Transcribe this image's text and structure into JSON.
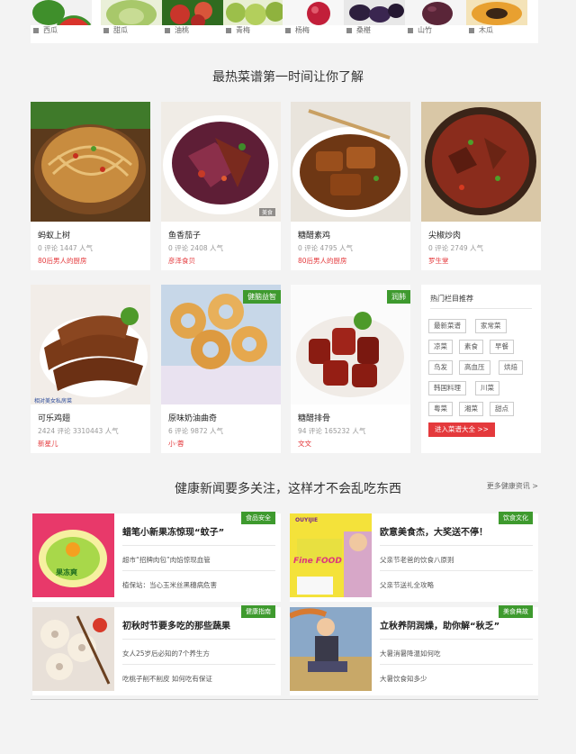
{
  "fruits": [
    {
      "label": "西瓜",
      "color": "#3f8f2b"
    },
    {
      "label": "甜瓜",
      "color": "#a8c86a"
    },
    {
      "label": "油桃",
      "color": "#c9352b"
    },
    {
      "label": "青梅",
      "color": "#9cbf4a"
    },
    {
      "label": "杨梅",
      "color": "#c21f3a"
    },
    {
      "label": "桑椹",
      "color": "#2d1f3d"
    },
    {
      "label": "山竹",
      "color": "#5a2538"
    },
    {
      "label": "木瓜",
      "color": "#e8a030"
    }
  ],
  "recipes_section": {
    "title": "最热菜谱第一时间让你了解"
  },
  "recipes": [
    {
      "name": "蚂蚁上树",
      "stats": "0 评论  1447 人气",
      "author": "80后男人的厨房",
      "tag": ""
    },
    {
      "name": "鱼香茄子",
      "stats": "0 评论  2408 人气",
      "author": "彦泽食贝",
      "tag": ""
    },
    {
      "name": "糖醋素鸡",
      "stats": "0 评论  4795 人气",
      "author": "80后男人的厨房",
      "tag": ""
    },
    {
      "name": "尖椒炒肉",
      "stats": "0 评论  2749 人气",
      "author": "罗生堂",
      "tag": ""
    },
    {
      "name": "可乐鸡翅",
      "stats": "2424 评论  3310443 人气",
      "author": "新星儿",
      "tag": ""
    },
    {
      "name": "原味奶油曲奇",
      "stats": "6 评论  9872 人气",
      "author": "小·蓉",
      "tag": "健脑益智"
    },
    {
      "name": "糖醋排骨",
      "stats": "94 评论  165232 人气",
      "author": "文文",
      "tag": "润肺"
    }
  ],
  "recipe_overlays": {
    "fish_promo": "美食",
    "wings_caption": "相对美女私房菜"
  },
  "hot": {
    "title": "热门栏目推荐",
    "tags": [
      "最新菜谱",
      "家常菜",
      "凉菜",
      "素食",
      "早餐",
      "鸟发",
      "高血压",
      "烘焙",
      "韩国料理",
      "川菜",
      "粤菜",
      "湘菜",
      "甜点"
    ],
    "button": "进入菜谱大全 >>"
  },
  "news_section": {
    "title": "健康新闻要多关注，这样才不会乱吃东西",
    "more": "更多健康资讯 >"
  },
  "news": [
    {
      "title": "蜡笔小新果冻惊现“蚊子”",
      "tag": "食品安全",
      "lines": [
        "超市“招牌肉包”肉馅惊现血管",
        "植保站：当心玉米丝黑穗病危害"
      ]
    },
    {
      "title": "欧意美食杰，大奖送不停！",
      "tag": "饮食文化",
      "lines": [
        "父亲节老爸的饮食八原则",
        "父亲节送礼全攻略"
      ]
    },
    {
      "title": "初秋时节要多吃的那些蔬果",
      "tag": "健康指南",
      "lines": [
        "女人25岁后必知的7个养生方",
        "吃桃子削不削皮 如何吃有保证"
      ]
    },
    {
      "title": "立秋养阴润燥，助你解“秋乏”",
      "tag": "美食典故",
      "lines": [
        "大暑消暑降温如何吃",
        "大暑饮食知多少"
      ]
    }
  ],
  "news_overlays": {
    "jelly_brand": "果冻爽",
    "fine_food": "Fine FOOD",
    "brand_logo": "OUYIJIE"
  },
  "colors": {
    "accent_red": "#e4393c",
    "tag_green": "#3e9a2e",
    "background": "#f3f3f3"
  }
}
